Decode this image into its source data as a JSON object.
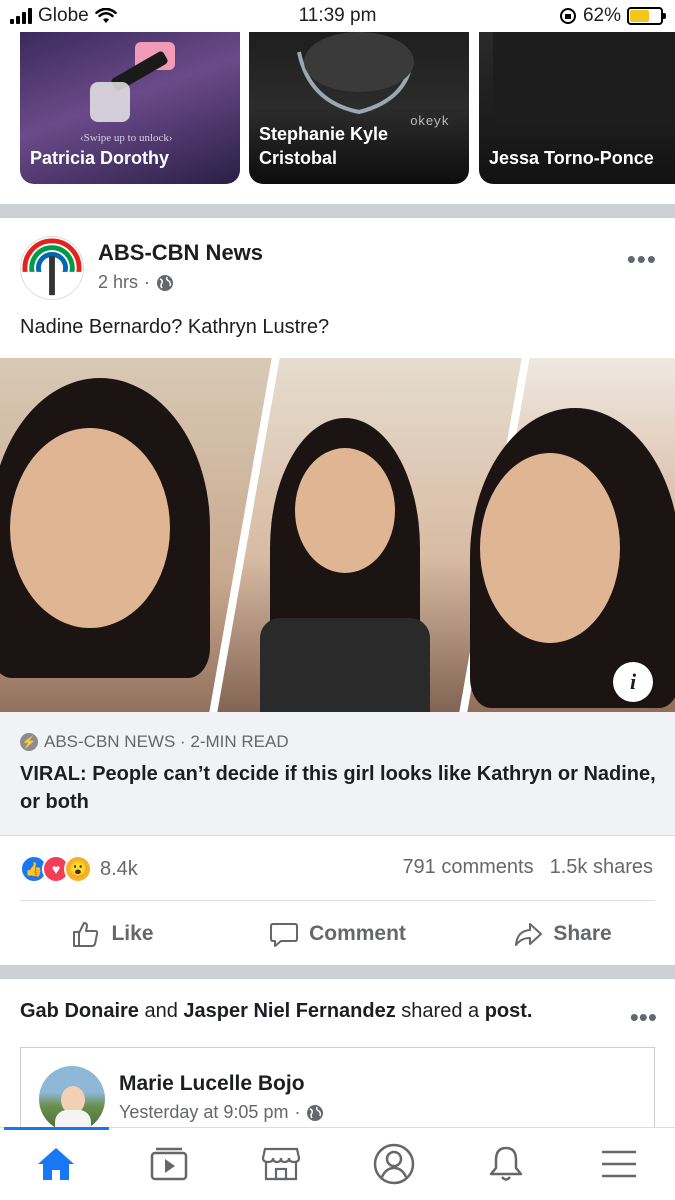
{
  "status_bar": {
    "carrier": "Globe",
    "time": "11:39 pm",
    "battery": "62%",
    "battery_level": 0.62
  },
  "stories": [
    {
      "name": "Patricia Dorothy",
      "overlay": "‹Swipe up to unlock›"
    },
    {
      "name": "Stephanie Kyle Cristobal",
      "overlay": "okeyk"
    },
    {
      "name": "Jessa Torno-Ponce"
    }
  ],
  "post": {
    "page_name": "ABS-CBN News",
    "time": "2 hrs",
    "dot": "·",
    "text": "Nadine Bernardo? Kathryn Lustre?",
    "link_source": "ABS-CBN NEWS · 2-MIN READ",
    "link_title": "VIRAL: People can’t decide if this girl looks like Kathryn or Nadine, or both",
    "reaction_count": "8.4k",
    "comments": "791 comments",
    "shares": "1.5k shares",
    "actions": {
      "like": "Like",
      "comment": "Comment",
      "share": "Share"
    }
  },
  "shared": {
    "user1": "Gab Donaire",
    "and": "and",
    "user2": "Jasper Niel Fernandez",
    "shared_a": "shared a",
    "post_word": "post.",
    "author": "Marie Lucelle Bojo",
    "time": "Yesterday at 9:05 pm",
    "dot": "·"
  },
  "tabs": [
    "home-icon",
    "watch-icon",
    "marketplace-icon",
    "profile-icon",
    "notifications-icon",
    "menu-icon"
  ],
  "colors": {
    "accent": "#1877f2",
    "separator": "#ccd0d5",
    "muted": "#65676b"
  }
}
